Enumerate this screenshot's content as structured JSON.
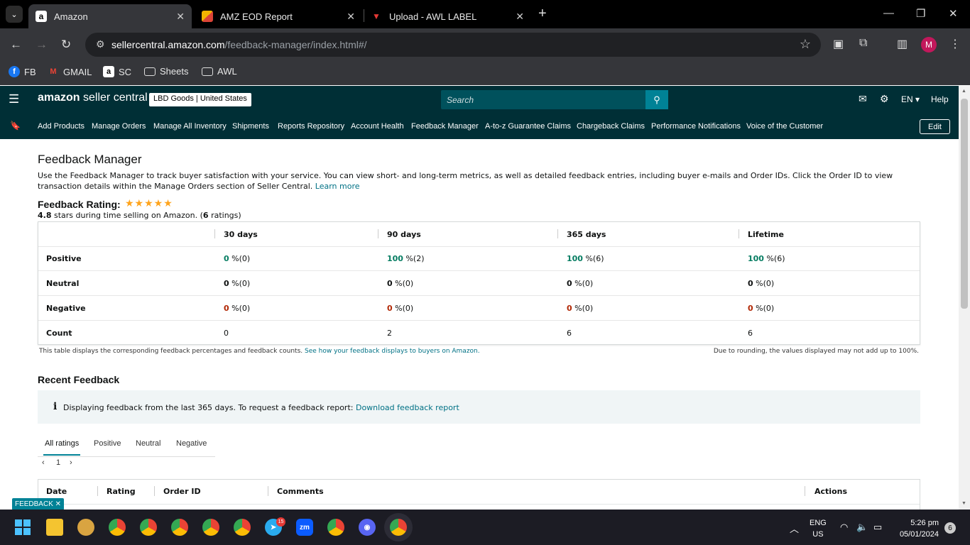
{
  "browser": {
    "tabs": [
      {
        "title": "Amazon",
        "favicon": "a"
      },
      {
        "title": "AMZ EOD Report",
        "favicon": "sheets"
      },
      {
        "title": "Upload - AWL LABEL",
        "favicon": "awl"
      }
    ],
    "url_host": "sellercentral.amazon.com",
    "url_path": "/feedback-manager/index.html#/",
    "profile_initial": "M",
    "bookmarks": [
      "FB",
      "GMAIL",
      "SC",
      "Sheets",
      "AWL"
    ]
  },
  "header": {
    "logo_main": "amazon",
    "logo_sub": " seller central",
    "account": "LBD Goods | United States",
    "search_placeholder": "Search",
    "lang": "EN ▾",
    "help": "Help"
  },
  "nav": {
    "items": [
      "Add Products",
      "Manage Orders",
      "Manage All Inventory",
      "Shipments",
      "Reports Repository",
      "Account Health",
      "Feedback Manager",
      "A-to-z Guarantee Claims",
      "Chargeback Claims",
      "Performance Notifications",
      "Voice of the Customer"
    ],
    "edit": "Edit"
  },
  "page": {
    "title": "Feedback Manager",
    "description": "Use the Feedback Manager to track buyer satisfaction with your service. You can view short- and long-term metrics, as well as detailed feedback entries, including buyer e-mails and Order IDs. Click the Order ID to view transaction details within the Manage Orders section of Seller Central.",
    "learn_more": "Learn more",
    "rating_label": "Feedback Rating:",
    "stars": "★★★★★",
    "rating_value": "4.8",
    "rating_text": " stars during time selling on Amazon. (",
    "rating_count": "6",
    "rating_suffix": " ratings)"
  },
  "feedback_table": {
    "columns": [
      "30 days",
      "90 days",
      "365 days",
      "Lifetime"
    ],
    "rows": [
      {
        "label": "Positive",
        "cells": [
          [
            "0",
            " %(0)"
          ],
          [
            "100",
            " %(2)"
          ],
          [
            "100",
            " %(6)"
          ],
          [
            "100",
            " %(6)"
          ]
        ]
      },
      {
        "label": "Neutral",
        "cells": [
          [
            "0",
            " %(0)"
          ],
          [
            "0",
            " %(0)"
          ],
          [
            "0",
            " %(0)"
          ],
          [
            "0",
            " %(0)"
          ]
        ]
      },
      {
        "label": "Negative",
        "cells": [
          [
            "0",
            " %(0)"
          ],
          [
            "0",
            " %(0)"
          ],
          [
            "0",
            " %(0)"
          ],
          [
            "0",
            " %(0)"
          ]
        ]
      },
      {
        "label": "Count",
        "cells": [
          [
            "0",
            ""
          ],
          [
            "2",
            ""
          ],
          [
            "6",
            ""
          ],
          [
            "6",
            ""
          ]
        ]
      }
    ],
    "note_left": "This table displays the corresponding feedback percentages and feedback counts.",
    "note_link": "See how your feedback displays to buyers on Amazon.",
    "note_right": "Due to rounding, the values displayed may not add up to 100%."
  },
  "recent": {
    "title": "Recent Feedback",
    "info_icon": "i",
    "info_text": "Displaying feedback from the last 365 days. To request a feedback report:",
    "info_link": "Download feedback report",
    "tabs": [
      "All ratings",
      "Positive",
      "Neutral",
      "Negative"
    ],
    "page": "1",
    "columns": [
      "Date",
      "Rating",
      "Order ID",
      "Comments",
      "Actions"
    ]
  },
  "feedback_button": "FEEDBACK ✕",
  "taskbar": {
    "lang1": "ENG",
    "lang2": "US",
    "time": "5:26 pm",
    "date": "05/01/2024",
    "notifications": "6",
    "telegram_badge": "15"
  }
}
